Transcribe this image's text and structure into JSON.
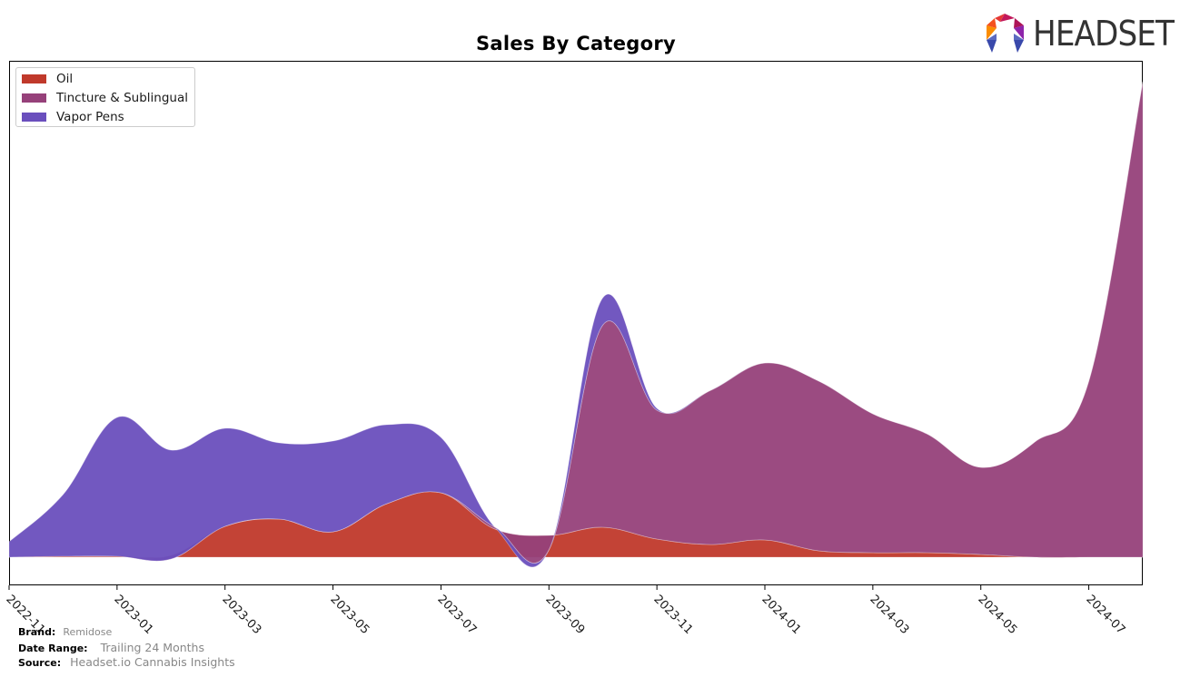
{
  "brand_logo": {
    "text": "HEADSET",
    "icon": "headset-logo-icon"
  },
  "footer": {
    "brand_label": "Brand:",
    "brand_value": "Remidose",
    "date_range_label": "Date Range:",
    "date_range_value": "Trailing 24 Months",
    "source_label": "Source:",
    "source_value": "Headset.io Cannabis Insights"
  },
  "chart_data": {
    "type": "area",
    "stacked": true,
    "smoothed": true,
    "title": "Sales By Category",
    "xlabel": "",
    "ylabel": "",
    "grid": false,
    "legend_position": "top-left",
    "x": [
      "2022-11",
      "2022-12",
      "2023-01",
      "2023-02",
      "2023-03",
      "2023-04",
      "2023-05",
      "2023-06",
      "2023-07",
      "2023-08",
      "2023-09",
      "2023-10",
      "2023-11",
      "2023-12",
      "2024-01",
      "2024-02",
      "2024-03",
      "2024-04",
      "2024-05",
      "2024-06",
      "2024-07",
      "2024-08"
    ],
    "tick_labels": [
      "2022-11",
      "2023-01",
      "2023-03",
      "2023-05",
      "2023-07",
      "2023-09",
      "2023-11",
      "2024-01",
      "2024-03",
      "2024-05",
      "2024-07"
    ],
    "ylim": [
      -10,
      550
    ],
    "series": [
      {
        "name": "Oil",
        "color": "#c0392b",
        "values": [
          0,
          1,
          1,
          2,
          34,
          42,
          28,
          59,
          71,
          31,
          24,
          33,
          20,
          14,
          19,
          7,
          5,
          5,
          3,
          0,
          0,
          0
        ]
      },
      {
        "name": "Tincture & Sublingual",
        "color": "#96417a",
        "values": [
          0,
          0,
          0,
          -4,
          0,
          0,
          0,
          0,
          0,
          2,
          -16,
          223,
          142,
          170,
          195,
          187,
          153,
          131,
          96,
          127,
          194,
          524
        ]
      },
      {
        "name": "Vapor Pens",
        "color": "#6a4fbd",
        "values": [
          17,
          68,
          153,
          120,
          108,
          84,
          100,
          87,
          61,
          0,
          0,
          30,
          2,
          0,
          0,
          0,
          0,
          0,
          0,
          0,
          0,
          0
        ]
      }
    ]
  }
}
